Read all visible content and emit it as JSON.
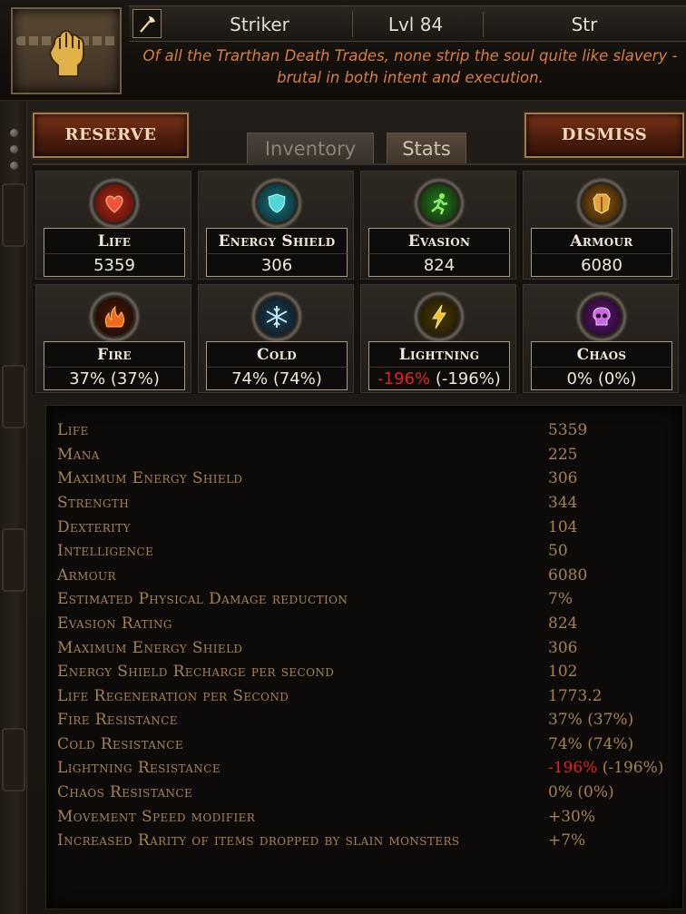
{
  "header": {
    "weapon_icon": "axe-icon",
    "portrait_icon": "chained-fist-icon",
    "name": "Striker",
    "level": "Lvl 84",
    "attribute": "Str",
    "flavor_line1": "Of all the Trarthan Death Trades, none strip the soul quite like slavery -",
    "flavor_line2": "brutal in both intent and execution."
  },
  "buttons": {
    "reserve": "RESERVE",
    "dismiss": "DISMISS"
  },
  "tabs": {
    "inventory": "Inventory",
    "stats": "Stats",
    "active": "stats"
  },
  "cards": [
    {
      "name": "Life",
      "value": "5359",
      "icon": "heart-icon"
    },
    {
      "name": "Energy Shield",
      "value": "306",
      "icon": "energy-shield-icon"
    },
    {
      "name": "Evasion",
      "value": "824",
      "icon": "running-figure-icon"
    },
    {
      "name": "Armour",
      "value": "6080",
      "icon": "chest-armour-icon"
    },
    {
      "name": "Fire",
      "value": "37% (37%)",
      "icon": "flame-icon"
    },
    {
      "name": "Cold",
      "value": "74% (74%)",
      "icon": "snowflake-icon"
    },
    {
      "name": "Lightning",
      "value_neg": "-196%",
      "value_rest": " (-196%)",
      "icon": "lightning-bolt-icon"
    },
    {
      "name": "Chaos",
      "value": "0% (0%)",
      "icon": "chaos-skull-icon"
    }
  ],
  "stats": [
    {
      "name": "Life",
      "value": "5359"
    },
    {
      "name": "Mana",
      "value": "225"
    },
    {
      "name": "Maximum Energy Shield",
      "value": "306"
    },
    {
      "name": "Strength",
      "value": "344"
    },
    {
      "name": "Dexterity",
      "value": "104"
    },
    {
      "name": "Intelligence",
      "value": "50"
    },
    {
      "name": "Armour",
      "value": "6080"
    },
    {
      "name": "Estimated Physical Damage reduction",
      "value": "7%"
    },
    {
      "name": "Evasion Rating",
      "value": "824"
    },
    {
      "name": "Maximum Energy Shield",
      "value": "306"
    },
    {
      "name": "Energy Shield Recharge per second",
      "value": "102"
    },
    {
      "name": "Life Regeneration per Second",
      "value": "1773.2"
    },
    {
      "name": "Fire Resistance",
      "value": "37% (37%)"
    },
    {
      "name": "Cold Resistance",
      "value": "74% (74%)"
    },
    {
      "name": "Lightning Resistance",
      "value_neg": "-196%",
      "value_rest": " (-196%)"
    },
    {
      "name": "Chaos Resistance",
      "value": "0% (0%)"
    },
    {
      "name": "Movement Speed modifier",
      "value": "+30%"
    },
    {
      "name": "Increased Rarity of items dropped by slain monsters",
      "value": "+7%"
    }
  ],
  "colors": {
    "flavor": "#d9803a",
    "stat_text": "#a68250",
    "negative": "#e2231a",
    "button": "#7a3319"
  }
}
